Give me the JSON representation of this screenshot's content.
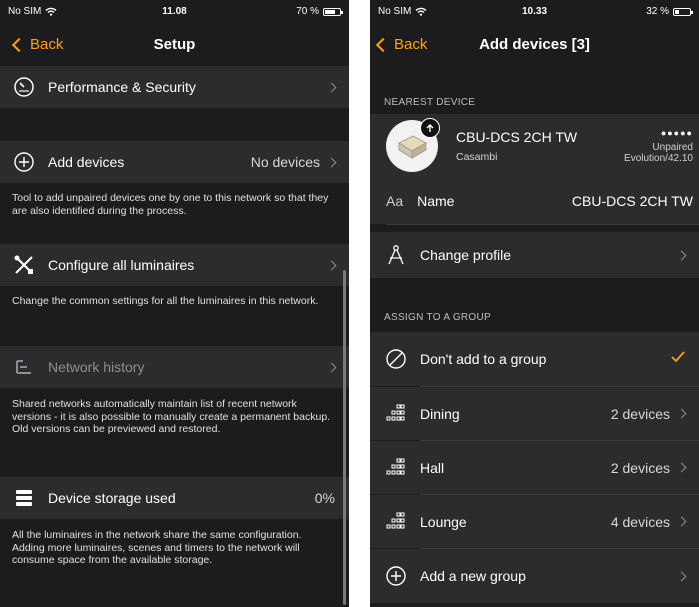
{
  "left": {
    "status": {
      "carrier": "No SIM",
      "time": "11.08",
      "battery": "70 %",
      "battery_level": 0.7
    },
    "nav": {
      "back_label": "Back",
      "title": "Setup"
    },
    "rows": {
      "performance": {
        "label": "Performance & Security",
        "icon": "gauge-icon"
      },
      "add_devices": {
        "label": "Add devices",
        "value": "No devices",
        "icon": "plus-circle-icon",
        "desc": "Tool to add unpaired devices one by one to this network so that they are also identified during the process."
      },
      "configure": {
        "label": "Configure all luminaires",
        "icon": "tools-icon",
        "desc": "Change the common settings for all the luminaires in this network."
      },
      "history": {
        "label": "Network history",
        "icon": "history-icon",
        "desc": "Shared networks automatically maintain list of recent network versions - it is also possible to manually create a permanent backup. Old versions can be previewed and restored."
      },
      "storage": {
        "label": "Device storage used",
        "value": "0%",
        "icon": "storage-icon",
        "desc": "All the luminaires in the network share the same configuration. Adding more luminaires, scenes and timers to the network will consume space from the available storage."
      }
    }
  },
  "right": {
    "status": {
      "carrier": "No SIM",
      "time": "10.33",
      "battery": "32 %",
      "battery_level": 0.32
    },
    "nav": {
      "back_label": "Back",
      "title": "Add devices [3]"
    },
    "nearest_header": "NEAREST DEVICE",
    "device": {
      "name": "CBU-DCS 2CH TW",
      "vendor": "Casambi",
      "signal": "●●●●●",
      "state": "Unpaired",
      "firmware": "Evolution/42.10"
    },
    "name_row": {
      "prefix": "Aa",
      "label": "Name",
      "value": "CBU-DCS 2CH TW"
    },
    "profile_row": {
      "label": "Change profile",
      "icon": "compass-icon"
    },
    "assign_header": "ASSIGN TO A GROUP",
    "groups": [
      {
        "label": "Don't add to a group",
        "value": "",
        "icon": "no-group-icon",
        "selected": true
      },
      {
        "label": "Dining",
        "value": "2 devices",
        "icon": "group-grid-icon",
        "selected": false
      },
      {
        "label": "Hall",
        "value": "2 devices",
        "icon": "group-grid-icon",
        "selected": false
      },
      {
        "label": "Lounge",
        "value": "4 devices",
        "icon": "group-grid-icon",
        "selected": false
      }
    ],
    "add_group": {
      "label": "Add a new group",
      "icon": "plus-circle-icon"
    },
    "colors": {
      "accent": "#ff9f0a",
      "cell": "#2c2c2e",
      "background": "#1c1c1e"
    }
  }
}
